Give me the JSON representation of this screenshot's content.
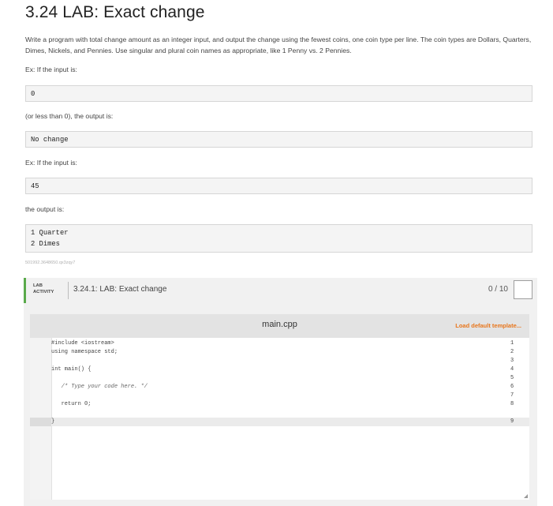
{
  "title": "3.24 LAB: Exact change",
  "description": "Write a program with total change amount as an integer input, and output the change using the fewest coins, one coin type per line. The coin types are Dollars, Quarters, Dimes, Nickels, and Pennies. Use singular and plural coin names as appropriate, like 1 Penny vs. 2 Pennies.",
  "examples": {
    "ex1_intro": "Ex: If the input is:",
    "ex1_input": "0",
    "ex1_mid": "(or less than 0), the output is:",
    "ex1_output": "No change",
    "ex2_intro": "Ex: If the input is:",
    "ex2_input": "45",
    "ex2_mid": "the output is:",
    "ex2_output": [
      "1 Quarter",
      "2 Dimes"
    ]
  },
  "uid": "501992.3648650.qx3zqy7",
  "lab": {
    "tag_line1": "LAB",
    "tag_line2": "ACTIVITY",
    "activity_title": "3.24.1: LAB: Exact change",
    "score": "0 / 10"
  },
  "editor": {
    "filename": "main.cpp",
    "load_template_label": "Load default template...",
    "line_numbers": [
      "1",
      "2",
      "3",
      "4",
      "5",
      "6",
      "7",
      "8",
      "9"
    ],
    "code_lines": [
      "#include <iostream>",
      "using namespace std;",
      "",
      "int main() {",
      "",
      "   /* Type your code here. */",
      "",
      "   return 0;",
      "}"
    ]
  },
  "colors": {
    "accent_green": "#5aaa4b",
    "template_link": "#e8761c"
  }
}
